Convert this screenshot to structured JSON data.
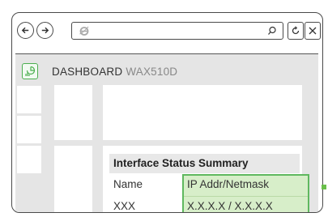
{
  "browser": {
    "address_value": "",
    "icons": [
      "back-icon",
      "forward-icon",
      "ie-logo-icon",
      "search-icon",
      "refresh-icon",
      "close-icon"
    ]
  },
  "dashboard": {
    "title": "DASHBOARD",
    "model": "WAX510D"
  },
  "interface_status": {
    "heading": "Interface Status Summary",
    "columns": [
      "Name",
      "IP Addr/Netmask"
    ],
    "rows": [
      [
        "XXX",
        "X.X.X.X / X.X.X.X"
      ]
    ]
  },
  "colors": {
    "highlight": "#d7eec9",
    "highlight_border": "#5fb85f",
    "panel_bg": "#e5e5e5"
  }
}
